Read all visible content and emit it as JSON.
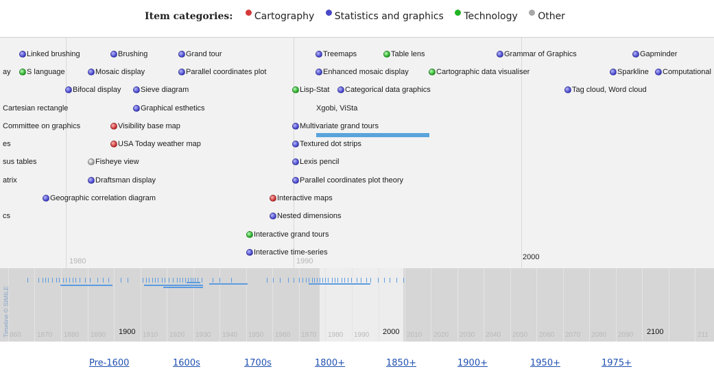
{
  "legend": {
    "title": "Item categories:",
    "items": [
      {
        "label": "Cartography",
        "color": "#c42828"
      },
      {
        "label": "Statistics and graphics",
        "color": "#3d3dc6"
      },
      {
        "label": "Technology",
        "color": "#1ea21e"
      },
      {
        "label": "Other",
        "color": "#9a9a9a"
      }
    ]
  },
  "main_band": {
    "decade_labels": [
      "1980",
      "1990"
    ],
    "century_labels": [
      "2000"
    ],
    "events": [
      {
        "label": "Linked brushing",
        "category": "stat"
      },
      {
        "label": "Brushing",
        "category": "stat"
      },
      {
        "label": "Grand tour",
        "category": "stat"
      },
      {
        "label": "Treemaps",
        "category": "stat"
      },
      {
        "label": "Table lens",
        "category": "tech"
      },
      {
        "label": "Grammar of Graphics",
        "category": "stat"
      },
      {
        "label": "Gapminder",
        "category": "stat"
      },
      {
        "label": "ay",
        "category": "none"
      },
      {
        "label": "S language",
        "category": "tech"
      },
      {
        "label": "Mosaic display",
        "category": "stat"
      },
      {
        "label": "Parallel coordinates plot",
        "category": "stat"
      },
      {
        "label": "Enhanced mosaic display",
        "category": "stat"
      },
      {
        "label": "Cartographic data visualiser",
        "category": "tech"
      },
      {
        "label": "Sparkline",
        "category": "stat"
      },
      {
        "label": "Computational",
        "category": "stat"
      },
      {
        "label": "Bifocal display",
        "category": "stat"
      },
      {
        "label": "Sieve diagram",
        "category": "stat"
      },
      {
        "label": "Lisp-Stat",
        "category": "tech"
      },
      {
        "label": "Categorical data graphics",
        "category": "stat"
      },
      {
        "label": "Tag cloud, Word cloud",
        "category": "stat"
      },
      {
        "label": "Cartesian rectangle",
        "category": "none"
      },
      {
        "label": "Graphical esthetics",
        "category": "stat"
      },
      {
        "label": "Xgobi, ViSta",
        "category": "none"
      },
      {
        "label": "Committee on graphics",
        "category": "none"
      },
      {
        "label": "Visibility base map",
        "category": "cart"
      },
      {
        "label": "Multivariate grand tours",
        "category": "stat"
      },
      {
        "label": "es",
        "category": "none"
      },
      {
        "label": "USA Today weather map",
        "category": "cart"
      },
      {
        "label": "Textured dot strips",
        "category": "stat"
      },
      {
        "label": "sus tables",
        "category": "none"
      },
      {
        "label": "Fisheye view",
        "category": "other"
      },
      {
        "label": "Lexis pencil",
        "category": "stat"
      },
      {
        "label": "atrix",
        "category": "none"
      },
      {
        "label": "Draftsman display",
        "category": "stat"
      },
      {
        "label": "Parallel coordinates plot theory",
        "category": "stat"
      },
      {
        "label": "Geographic correlation diagram",
        "category": "stat"
      },
      {
        "label": "Interactive maps",
        "category": "cart"
      },
      {
        "label": "cs",
        "category": "none"
      },
      {
        "label": "Nested dimensions",
        "category": "stat"
      },
      {
        "label": "Interactive grand tours",
        "category": "tech"
      },
      {
        "label": "Interactive time-series",
        "category": "stat"
      }
    ]
  },
  "overview_band": {
    "credit": "Timeline © SIMILE",
    "decade_labels": [
      "860",
      "1870",
      "1880",
      "1890",
      "1910",
      "1920",
      "1930",
      "1940",
      "1950",
      "1960",
      "1970",
      "1980",
      "1990",
      "2010",
      "2020",
      "2030",
      "2040",
      "2050",
      "2060",
      "2070",
      "2080",
      "2090",
      "211"
    ],
    "century_labels": [
      "1900",
      "2000",
      "2100"
    ]
  },
  "nav": {
    "links": [
      "Pre-1600",
      "1600s",
      "1700s",
      "1800+",
      "1850+",
      "1900+",
      "1950+",
      "1975+"
    ]
  }
}
